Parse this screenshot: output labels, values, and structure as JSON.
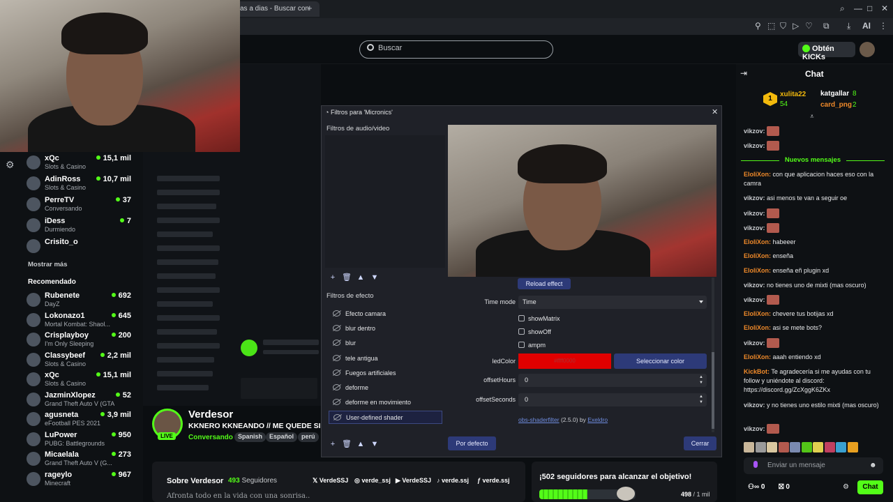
{
  "browser": {
    "tab_title": "as a dias - Buscar con",
    "new_tab": "+",
    "ai_label": "AI"
  },
  "header": {
    "search_placeholder": "Buscar",
    "kicks_button": "Obtén KICKs"
  },
  "sidebar": {
    "show_more": "Mostrar más",
    "recommended_heading": "Recomendado",
    "following": [
      {
        "name": "xQc",
        "category": "Slots & Casino",
        "viewers": "15,1 mil"
      },
      {
        "name": "AdinRoss",
        "category": "Slots & Casino",
        "viewers": "10,7 mil"
      },
      {
        "name": "PerreTV",
        "category": "Conversando",
        "viewers": "37"
      },
      {
        "name": "iDess",
        "category": "Durmiendo",
        "viewers": "7"
      },
      {
        "name": "Crisito_o",
        "category": "",
        "viewers": ""
      }
    ],
    "recommended": [
      {
        "name": "Rubenete",
        "category": "DayZ",
        "viewers": "692"
      },
      {
        "name": "Lokonazo1",
        "category": "Mortal Kombat: Shaol...",
        "viewers": "645"
      },
      {
        "name": "Crisplayboy",
        "category": "I'm Only Sleeping",
        "viewers": "200"
      },
      {
        "name": "Classybeef",
        "category": "Slots & Casino",
        "viewers": "2,2 mil"
      },
      {
        "name": "xQc",
        "category": "Slots & Casino",
        "viewers": "15,1 mil"
      },
      {
        "name": "JazminXlopez",
        "category": "Grand Theft Auto V (GTA)",
        "viewers": "52"
      },
      {
        "name": "agusneta",
        "category": "eFootball PES 2021",
        "viewers": "3,9 mil"
      },
      {
        "name": "LuPower",
        "category": "PUBG: Battlegrounds",
        "viewers": "950"
      },
      {
        "name": "Micaelala",
        "category": "Grand Theft Auto V (G...",
        "viewers": "273"
      },
      {
        "name": "rageylo",
        "category": "Minecraft",
        "viewers": "967"
      }
    ]
  },
  "channel": {
    "name": "Verdesor",
    "live": "LIVE",
    "title": "KKNERO KKNEANDO // ME QUEDE SIN IDE",
    "category": "Conversando",
    "tags": [
      "Spanish",
      "Español",
      "perú"
    ],
    "about_title": "Sobre Verdesor",
    "followers_count": "493",
    "followers_label": "Seguidores",
    "description": "Afronta todo en la vida con una sonrisa..",
    "socials": [
      "VerdeSSJ",
      "verde_ssj",
      "VerdeSSJ",
      "verde.ssj",
      "verde.ssj"
    ]
  },
  "goal": {
    "title": "¡502 seguidores para alcanzar el objetivo!",
    "current": "498",
    "target": "/ 1 mil",
    "progress_fraction": 0.498
  },
  "dialog": {
    "title": "Filtros para 'Micronics'",
    "audio_video_label": "Filtros de audio/video",
    "effects_label": "Filtros de efecto",
    "effects": [
      "Efecto camara",
      "blur dentro",
      "blur",
      "tele antigua",
      "Fuegos artificiales",
      "deforme",
      "deforme en movimiento",
      "User-defined shader"
    ],
    "selected_effect": "User-defined shader",
    "reload_button": "Reload effect",
    "time_mode_label": "Time mode",
    "time_mode_value": "Time",
    "checkboxes": [
      "showMatrix",
      "showOff",
      "ampm"
    ],
    "led_color_label": "ledColor",
    "led_color_value": "#ffff0000",
    "led_color_hex": "#e00000",
    "select_color_button": "Seleccionar color",
    "offset_hours_label": "offsetHours",
    "offset_hours_value": "0",
    "offset_seconds_label": "offsetSeconds",
    "offset_seconds_value": "0",
    "credit_link": "obs-shaderfilter",
    "credit_version": "(2.5.0) by",
    "credit_author": "Exeldro",
    "default_button": "Por defecto",
    "close_button": "Cerrar",
    "toolbar": {
      "add": "+",
      "remove": "🗑",
      "up": "▲",
      "down": "▼"
    }
  },
  "chat": {
    "title": "Chat",
    "top_gifters": [
      {
        "name": "xulita22",
        "count": "54",
        "rank": "1"
      },
      {
        "name": "katgallar",
        "count": "8"
      },
      {
        "name": "card_png",
        "count": "2"
      }
    ],
    "new_messages_label": "Nuevos mensajes",
    "messages": [
      {
        "user": "vikzov:",
        "text": "",
        "emote": true,
        "orange": false
      },
      {
        "user": "vikzov:",
        "text": "",
        "emote": true,
        "orange": false
      },
      {
        "user": "EloliXon:",
        "text": "con que aplicacion haces eso con la camra",
        "emote": false,
        "orange": true
      },
      {
        "user": "vikzov:",
        "text": "asi menos te van a seguir oe",
        "emote": false,
        "orange": false
      },
      {
        "user": "vikzov:",
        "text": "",
        "emote": true,
        "orange": false
      },
      {
        "user": "vikzov:",
        "text": "",
        "emote": true,
        "orange": false
      },
      {
        "user": "EloliXon:",
        "text": "habeeer",
        "emote": false,
        "orange": true
      },
      {
        "user": "EloliXon:",
        "text": "enseña",
        "emote": false,
        "orange": true
      },
      {
        "user": "EloliXon:",
        "text": "enseña eñ plugin xd",
        "emote": false,
        "orange": true
      },
      {
        "user": "vikzov:",
        "text": "no tienes uno de mixti (mas oscuro)",
        "emote": false,
        "orange": false
      },
      {
        "user": "vikzov:",
        "text": "",
        "emote": true,
        "orange": false
      },
      {
        "user": "EloliXon:",
        "text": "chevere tus botijas xd",
        "emote": false,
        "orange": true
      },
      {
        "user": "EloliXon:",
        "text": "asi se mete bots?",
        "emote": false,
        "orange": true
      },
      {
        "user": "vikzov:",
        "text": "",
        "emote": true,
        "orange": false
      },
      {
        "user": "EloliXon:",
        "text": "aaah entiendo xd",
        "emote": false,
        "orange": true
      },
      {
        "user": "KickBot:",
        "text": "Te agradecería si me ayudas con tu follow y uniéndote al discord: https://discord.gg/ZcXggK6ZKx",
        "emote": false,
        "orange": true
      },
      {
        "user": "vikzov:",
        "text": "y no tienes uno estilo mixti (mas oscuro)",
        "emote": false,
        "orange": false
      },
      {
        "user": "vikzov:",
        "text": "",
        "emote": true,
        "orange": false
      }
    ],
    "input_placeholder": "Enviar un mensaje",
    "points": "0",
    "gifts": "0",
    "send_button": "Chat"
  }
}
